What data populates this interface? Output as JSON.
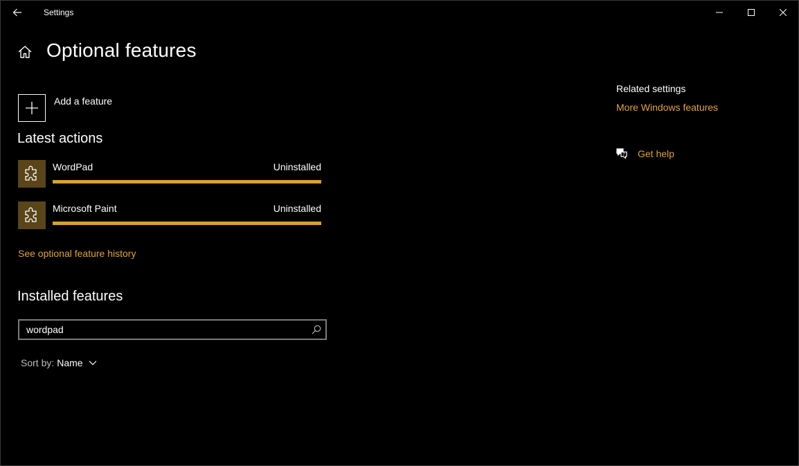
{
  "window": {
    "title": "Settings"
  },
  "titlebar": {
    "back_icon": "back-arrow-icon",
    "controls": [
      "minimize-icon",
      "maximize-icon",
      "close-icon"
    ]
  },
  "page": {
    "title": "Optional features",
    "home_icon": "home-icon"
  },
  "add_feature": {
    "label": "Add a feature",
    "icon": "plus-icon"
  },
  "latest_actions": {
    "heading": "Latest actions",
    "items": [
      {
        "name": "WordPad",
        "status": "Uninstalled",
        "progress": 1.0,
        "icon": "puzzle-piece-icon"
      },
      {
        "name": "Microsoft Paint",
        "status": "Uninstalled",
        "progress": 1.0,
        "icon": "puzzle-piece-icon"
      }
    ],
    "history_link": "See optional feature history"
  },
  "installed": {
    "heading": "Installed features",
    "search": {
      "value": "wordpad",
      "icon": "search-icon"
    },
    "sort": {
      "label": "Sort by:",
      "value": "Name",
      "icon": "chevron-down-icon"
    }
  },
  "related": {
    "heading": "Related settings",
    "more_windows_features": "More Windows features",
    "get_help": "Get help",
    "help_icon": "help-chat-icon"
  },
  "colors": {
    "accent": "#d8a32b",
    "link": "#e0a23a",
    "tile": "#5a4519",
    "background": "#000000"
  }
}
